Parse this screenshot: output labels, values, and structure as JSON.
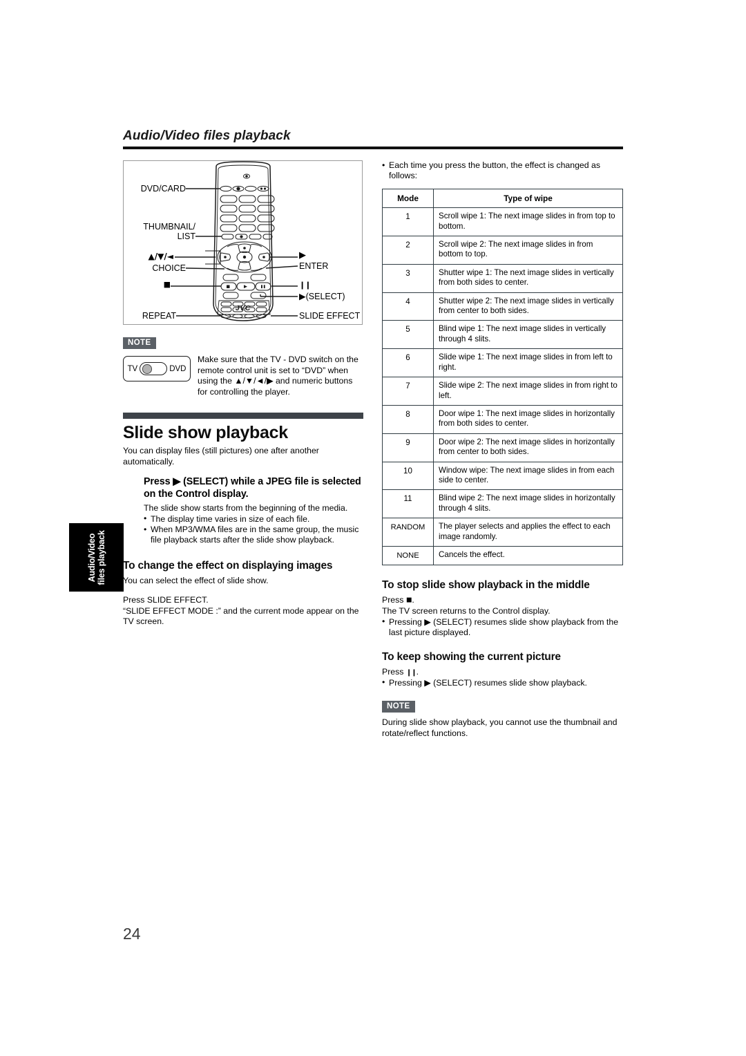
{
  "runhead": {
    "title": "Audio/Video files playback"
  },
  "side_tab": {
    "line1": "Audio/Video",
    "line2": "files playback"
  },
  "folio": {
    "page": "24"
  },
  "figure": {
    "name": "remote-control-diagram",
    "brand": "JVC",
    "labels_left": [
      {
        "text": "DVD/CARD",
        "name": "callout-dvd-card"
      },
      {
        "text": "THUMBNAIL/",
        "name": "callout-thumbnail-list-line1"
      },
      {
        "text": "LIST",
        "name": "callout-thumbnail-list-line2"
      },
      {
        "text": "▲/▼/◄",
        "name": "callout-cursor-keys"
      },
      {
        "text": "CHOICE",
        "name": "callout-choice"
      },
      {
        "text": "■",
        "name": "callout-stop"
      },
      {
        "text": "REPEAT",
        "name": "callout-repeat"
      }
    ],
    "labels_right": [
      {
        "text": "▶",
        "name": "callout-right-arrow"
      },
      {
        "text": "ENTER",
        "name": "callout-enter"
      },
      {
        "text": "❙❙",
        "name": "callout-pause"
      },
      {
        "text": "▶(SELECT)",
        "name": "callout-play-select"
      },
      {
        "text": "SLIDE EFFECT",
        "name": "callout-slide-effect"
      }
    ]
  },
  "note_top": {
    "tag": "NOTE",
    "switch": {
      "left_label": "TV",
      "right_label": "DVD"
    },
    "text": "Make sure that the TV - DVD switch on the remote control unit is set to “DVD” when using the ▲/▼/◄/▶ and numeric buttons for controlling the player."
  },
  "section": {
    "title": "Slide show playback",
    "intro": "You can display files (still pictures) one after another automatically.",
    "step": "Press ▶ (SELECT) while a JPEG file is selected on the Control display.",
    "step_note": "The slide show starts from the beginning of the media.",
    "step_bullets": [
      "The display time varies in size of each file.",
      "When MP3/WMA files are in the same group, the music file playback starts after the slide show playback."
    ]
  },
  "effect_section": {
    "heading": "To change the effect on displaying images",
    "line1": "You can select the effect of slide show.",
    "line2": "Press SLIDE EFFECT.",
    "line3": "“SLIDE EFFECT MODE :” and the current mode appear on the TV screen."
  },
  "right_intro": {
    "bullet": "Each time you press the button, the effect is changed as follows:"
  },
  "wipe_table": {
    "name": "slide-effect-mode-table",
    "headers": [
      "Mode",
      "Type of wipe"
    ],
    "rows": [
      {
        "mode": "1",
        "wipe": "Scroll wipe 1: The next image slides in from top to bottom."
      },
      {
        "mode": "2",
        "wipe": "Scroll wipe 2: The next image slides in from bottom to top."
      },
      {
        "mode": "3",
        "wipe": "Shutter wipe 1: The next image slides in vertically from both sides to center."
      },
      {
        "mode": "4",
        "wipe": "Shutter wipe 2: The next image slides in vertically from center to both sides."
      },
      {
        "mode": "5",
        "wipe": "Blind wipe 1: The next image slides in vertically through 4 slits."
      },
      {
        "mode": "6",
        "wipe": "Slide wipe 1: The next image slides in from left to right."
      },
      {
        "mode": "7",
        "wipe": "Slide wipe 2: The next image slides in from right to left."
      },
      {
        "mode": "8",
        "wipe": "Door wipe 1: The next image slides in horizontally from both sides to center."
      },
      {
        "mode": "9",
        "wipe": "Door wipe 2: The next image slides in horizontally from center to both sides."
      },
      {
        "mode": "10",
        "wipe": "Window wipe: The next image slides in from each side to center."
      },
      {
        "mode": "11",
        "wipe": "Blind wipe 2: The next image slides in horizontally through 4 slits."
      },
      {
        "mode": "RANDOM",
        "wipe": "The player selects and applies the effect to each image randomly."
      },
      {
        "mode": "NONE",
        "wipe": "Cancels the effect."
      }
    ]
  },
  "stop_section": {
    "heading": "To stop slide show playback in the middle",
    "line1_pre": "Press ",
    "line1_post": ".",
    "line2": "The TV screen returns to the Control display.",
    "bullet": "Pressing ▶ (SELECT) resumes slide show playback from the last picture displayed."
  },
  "keep_section": {
    "heading": "To keep showing the current picture",
    "line1_pre": "Press ",
    "line1_post": ".",
    "bullet": "Pressing ▶ (SELECT) resumes slide show playback."
  },
  "note_bottom": {
    "tag": "NOTE",
    "text": "During slide show playback, you cannot use the thumbnail and rotate/reflect functions."
  },
  "colors": {
    "heading_bar": "#3e4349",
    "note_tag_bg": "#5b6066",
    "table_border": "#2f3b42",
    "tab_bg": "#000000"
  }
}
